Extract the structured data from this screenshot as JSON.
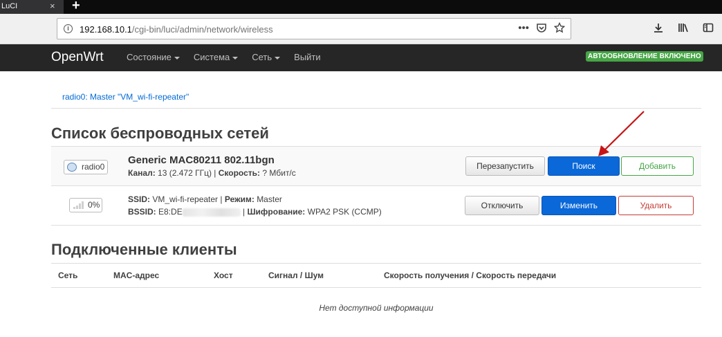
{
  "browser": {
    "tab_title": "LuCI",
    "tab_close": "×",
    "new_tab": "+",
    "url_host": "192.168.10.1",
    "url_path": "/cgi-bin/luci/admin/network/wireless"
  },
  "header": {
    "brand": "OpenWrt",
    "menu": [
      "Состояние",
      "Система",
      "Сеть",
      "Выйти"
    ],
    "autorefresh": "АВТООБНОВЛЕНИЕ ВКЛЮЧЕНО"
  },
  "breadcrumb": "radio0: Master \"VM_wi-fi-repeater\"",
  "wireless": {
    "title": "Список беспроводных сетей",
    "radio": {
      "badge": "radio0",
      "name": "Generic MAC80211 802.11bgn",
      "channel_label": "Канал:",
      "channel_value": "13 (2.472 ГГц)",
      "rate_label": "Скорость:",
      "rate_value": "? Мбит/с",
      "buttons": {
        "restart": "Перезапустить",
        "scan": "Поиск",
        "add": "Добавить"
      }
    },
    "network": {
      "signal": "0%",
      "ssid_label": "SSID:",
      "ssid_value": "VM_wi-fi-repeater",
      "mode_label": "Режим:",
      "mode_value": "Master",
      "bssid_label": "BSSID:",
      "bssid_value": "E8:DE",
      "enc_label": "Шифрование:",
      "enc_value": "WPA2 PSK (CCMP)",
      "buttons": {
        "disable": "Отключить",
        "edit": "Изменить",
        "remove": "Удалить"
      }
    }
  },
  "clients": {
    "title": "Подключенные клиенты",
    "columns": [
      "Сеть",
      "MAC-адрес",
      "Хост",
      "Сигнал / Шум",
      "Скорость получения / Скорость передачи"
    ],
    "empty": "Нет доступной информации"
  },
  "colors": {
    "header_bg": "#262626",
    "primary": "#0a68d8",
    "success": "#46a546",
    "danger": "#c43c35",
    "arrow": "#c81414"
  }
}
